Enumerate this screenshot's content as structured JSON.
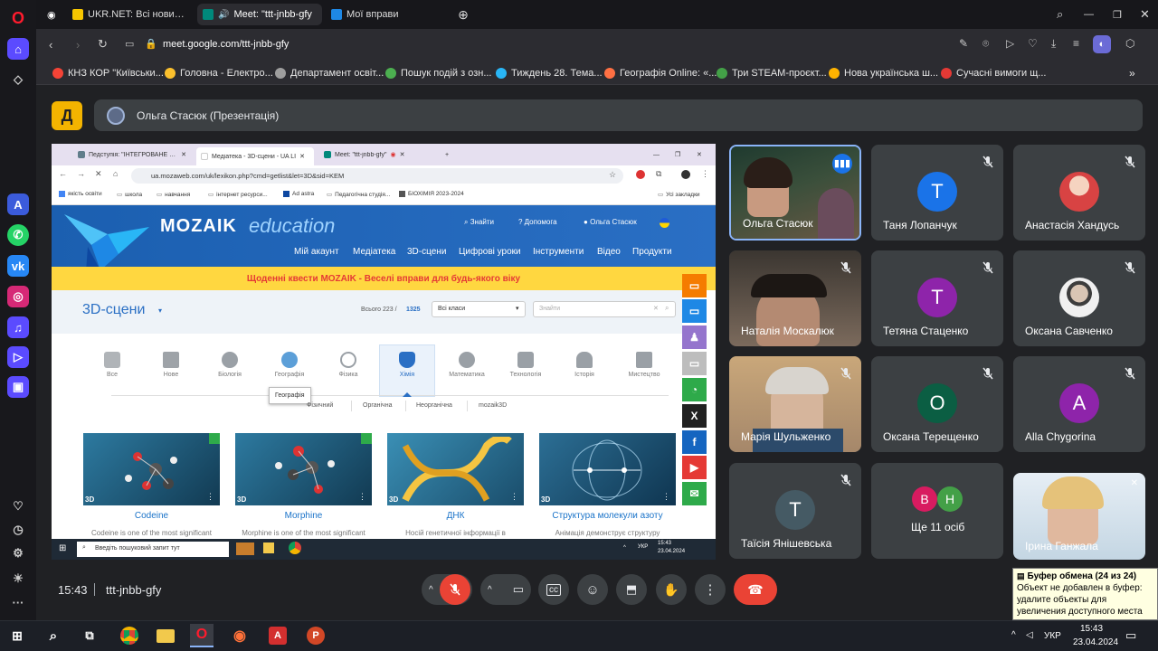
{
  "browser": {
    "tabs": [
      {
        "label": "UKR.NET: Всі новини Укр",
        "color": "#f7c600"
      },
      {
        "label": "Meet: \"ttt-jnbb-gfy",
        "color": "#00897b"
      },
      {
        "label": "Мої вправи",
        "color": "#1e88e5"
      }
    ],
    "url": "meet.google.com/ttt-jnbb-gfy",
    "bookmarks": [
      {
        "label": "КНЗ КОР \"Київськи...",
        "color": "#f44336"
      },
      {
        "label": "Головна - Електро...",
        "color": "#fbc02d"
      },
      {
        "label": "Департамент освіт...",
        "color": "#9e9e9e"
      },
      {
        "label": "Пошук подій з озн...",
        "color": "#4caf50"
      },
      {
        "label": "Тиждень 28. Тема...",
        "color": "#29b6f6"
      },
      {
        "label": "Географія Online: «...",
        "color": "#ff7043"
      },
      {
        "label": "Три STEAM-проєкт...",
        "color": "#43a047"
      },
      {
        "label": "Нова українська ш...",
        "color": "#ffb300"
      },
      {
        "label": "Сучасні вимоги щ...",
        "color": "#e53935"
      }
    ]
  },
  "meet": {
    "logo": "Д",
    "presenter_name": "Ольга Стасюк (Презентація)",
    "time": "15:43",
    "meeting_code": "ttt-jnbb-gfy",
    "participants": [
      {
        "name": "Ольга Стасюк",
        "type": "video",
        "speaking": true
      },
      {
        "name": "Таня Лопанчук",
        "type": "avatar",
        "initial": "Т",
        "color": "#1a73e8"
      },
      {
        "name": "Анастасія Хандусь",
        "type": "photo",
        "color": "#d84343"
      },
      {
        "name": "Наталія Москалюк",
        "type": "video"
      },
      {
        "name": "Тетяна Стаценко",
        "type": "avatar",
        "initial": "Т",
        "color": "#8e24aa"
      },
      {
        "name": "Оксана Савченко",
        "type": "photo",
        "color": "#e0e0e0"
      },
      {
        "name": "Марія Шульженко",
        "type": "video"
      },
      {
        "name": "Оксана Терещенко",
        "type": "avatar",
        "initial": "О",
        "color": "#0b5e43"
      },
      {
        "name": "Alla Chygorina",
        "type": "avatar",
        "initial": "A",
        "color": "#8e24aa"
      },
      {
        "name": "Таїсія Янішевська",
        "type": "avatar",
        "initial": "Т",
        "color": "#455a64"
      },
      {
        "name": "Ще 11 осіб",
        "type": "group",
        "initials": [
          "В",
          "Н"
        ],
        "colors": [
          "#d81b60",
          "#43a047"
        ]
      },
      {
        "name": "Ірина Ганжала",
        "type": "video"
      }
    ]
  },
  "presentation": {
    "tabs": [
      "Педступія: \"ІНТЕГРОВАНЕ НА",
      "Медіатека - 3D-сцени - UA LI",
      "Meet: \"ttt-jnbb-gfy\""
    ],
    "url": "ua.mozaweb.com/uk/lexikon.php?cmd=getlist&let=3D&sid=KEM",
    "bookmarks": [
      "якість освіти",
      "школа",
      "навчання",
      "інтернет ресурси...",
      "Ad astra",
      "Педагогічна студія...",
      "БІОХІМІЯ 2023-2024",
      "Усі закладки"
    ],
    "brand": "MOZAIK",
    "brand_suffix": "education",
    "header_links": [
      "Знайти",
      "Допомога",
      "Ольга Стасюк"
    ],
    "menu": [
      "Мій акаунт",
      "Медіатека",
      "3D-сцени",
      "Цифрові уроки",
      "Інструменти",
      "Відео",
      "Продукти"
    ],
    "banner": "Щоденні квести MOZAIK - Веселі вправи для будь-якого віку",
    "section_title": "3D-сцени",
    "count_prefix": "Всього 223 /",
    "count_total": "1325",
    "class_select": "Всі класи",
    "search_placeholder": "Знайти",
    "categories": [
      "Все",
      "Нове",
      "Біологія",
      "Географія",
      "Фізика",
      "Хімія",
      "Математика",
      "Технологія",
      "Історія",
      "Мистецтво"
    ],
    "tooltip": "Географія",
    "subcategories": [
      "Фізичний",
      "Органічна",
      "Неорганічна",
      "mozaik3D"
    ],
    "cards": [
      {
        "title": "Codeine",
        "desc": "Codeine is one of the most significant"
      },
      {
        "title": "Morphine",
        "desc": "Morphine is one of the most significant"
      },
      {
        "title": "ДНК",
        "desc": "Носій генетичної інформації в"
      },
      {
        "title": "Структура молекули азоту",
        "desc": "Анімація демонструє структуру"
      }
    ],
    "taskbar_search": "Введіть пошуковий запит тут",
    "taskbar_lang": "УКР",
    "taskbar_time": "15:43",
    "taskbar_date": "23.04.2024",
    "badge_3d": "3D"
  },
  "taskbar": {
    "lang": "УКР",
    "time": "15:43",
    "date": "23.04.2024"
  },
  "clipboard": {
    "title": "Буфер обмена (24 из 24)",
    "text": "Объект не добавлен в буфер: удалите объекты для увеличения доступного места"
  }
}
